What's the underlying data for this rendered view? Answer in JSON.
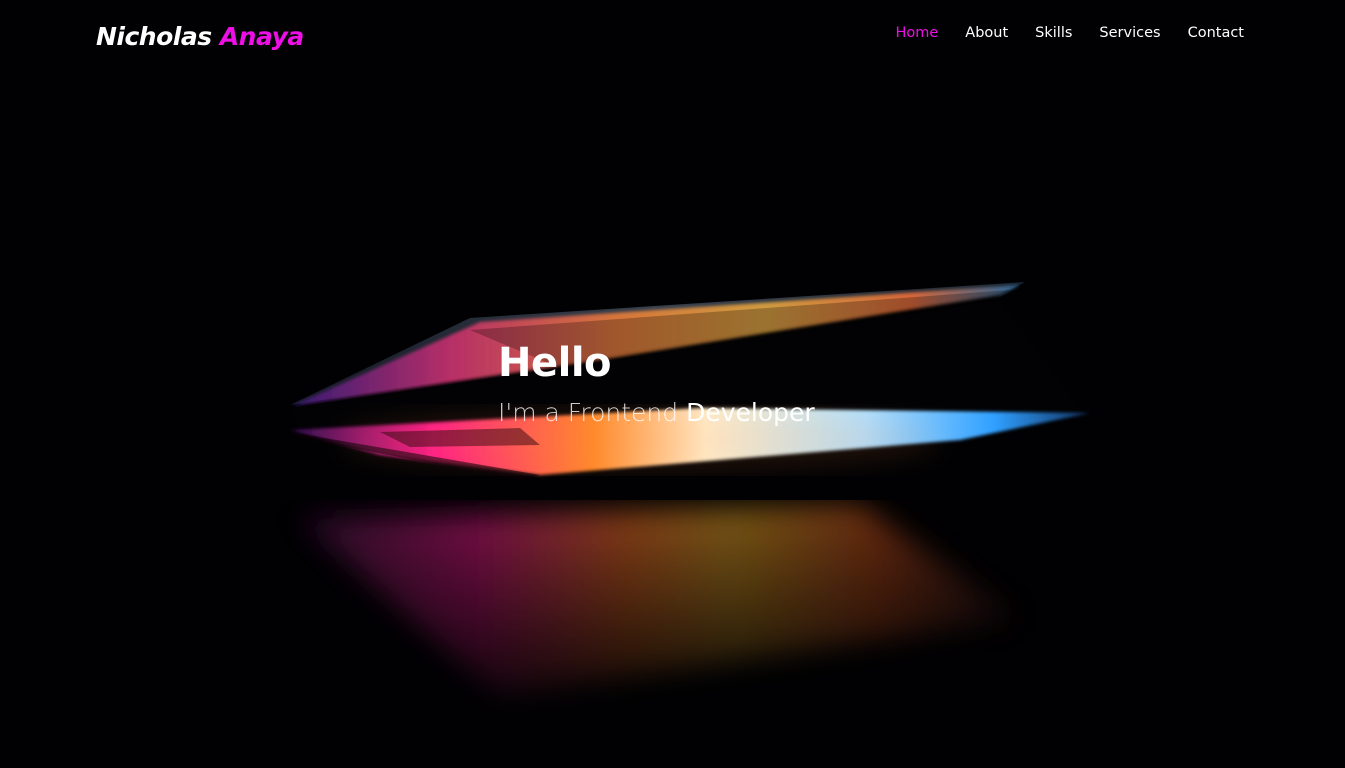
{
  "brand": {
    "first_name": "Nicholas",
    "last_name": "Anaya",
    "accent_color": "#ee0fe6"
  },
  "nav": {
    "items": [
      {
        "label": "Home",
        "active": true
      },
      {
        "label": "About",
        "active": false
      },
      {
        "label": "Skills",
        "active": false
      },
      {
        "label": "Services",
        "active": false
      },
      {
        "label": "Contact",
        "active": false
      }
    ]
  },
  "hero": {
    "heading": "Hello",
    "tagline_prefix": "I'm a Frontend",
    "tagline_role": "Developer",
    "background_image": "laptop-glow-image"
  }
}
